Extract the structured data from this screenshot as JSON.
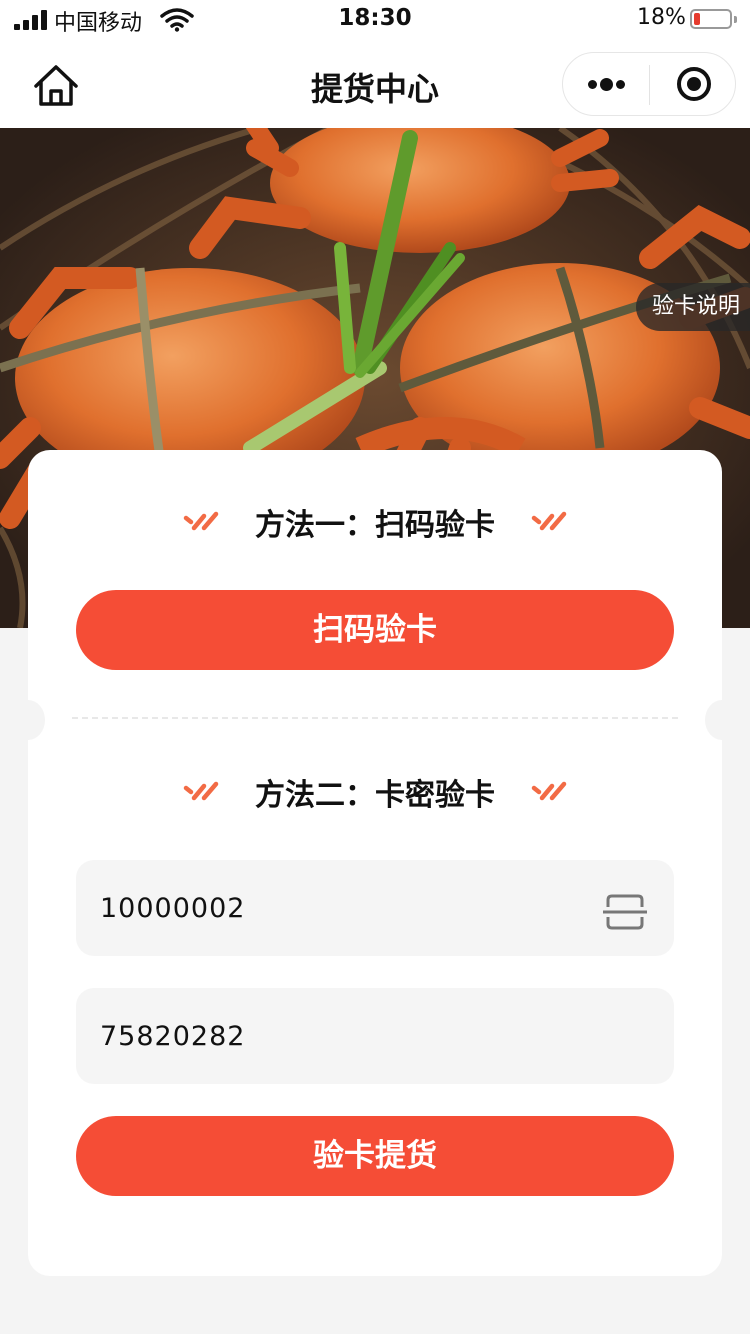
{
  "status_bar": {
    "carrier": "中国移动",
    "time": "18:30",
    "battery_percent": "18%",
    "battery_level": 0.18,
    "icons": [
      "signal-icon",
      "wifi-icon",
      "battery-icon"
    ]
  },
  "nav": {
    "title": "提货中心",
    "icons": [
      "home-icon",
      "more-icon",
      "close-miniprogram-icon"
    ]
  },
  "banner": {
    "rule_label": "验卡说明"
  },
  "method_one": {
    "title": "方法一：扫码验卡",
    "button_label": "扫码验卡"
  },
  "method_two": {
    "title": "方法二：卡密验卡",
    "card_number": "10000002",
    "card_password": "75820282",
    "submit_label": "验卡提货"
  },
  "colors": {
    "accent": "#f54d36",
    "decor": "#f26b45",
    "page_bg": "#f4f4f4",
    "field_bg": "#f5f5f5"
  }
}
